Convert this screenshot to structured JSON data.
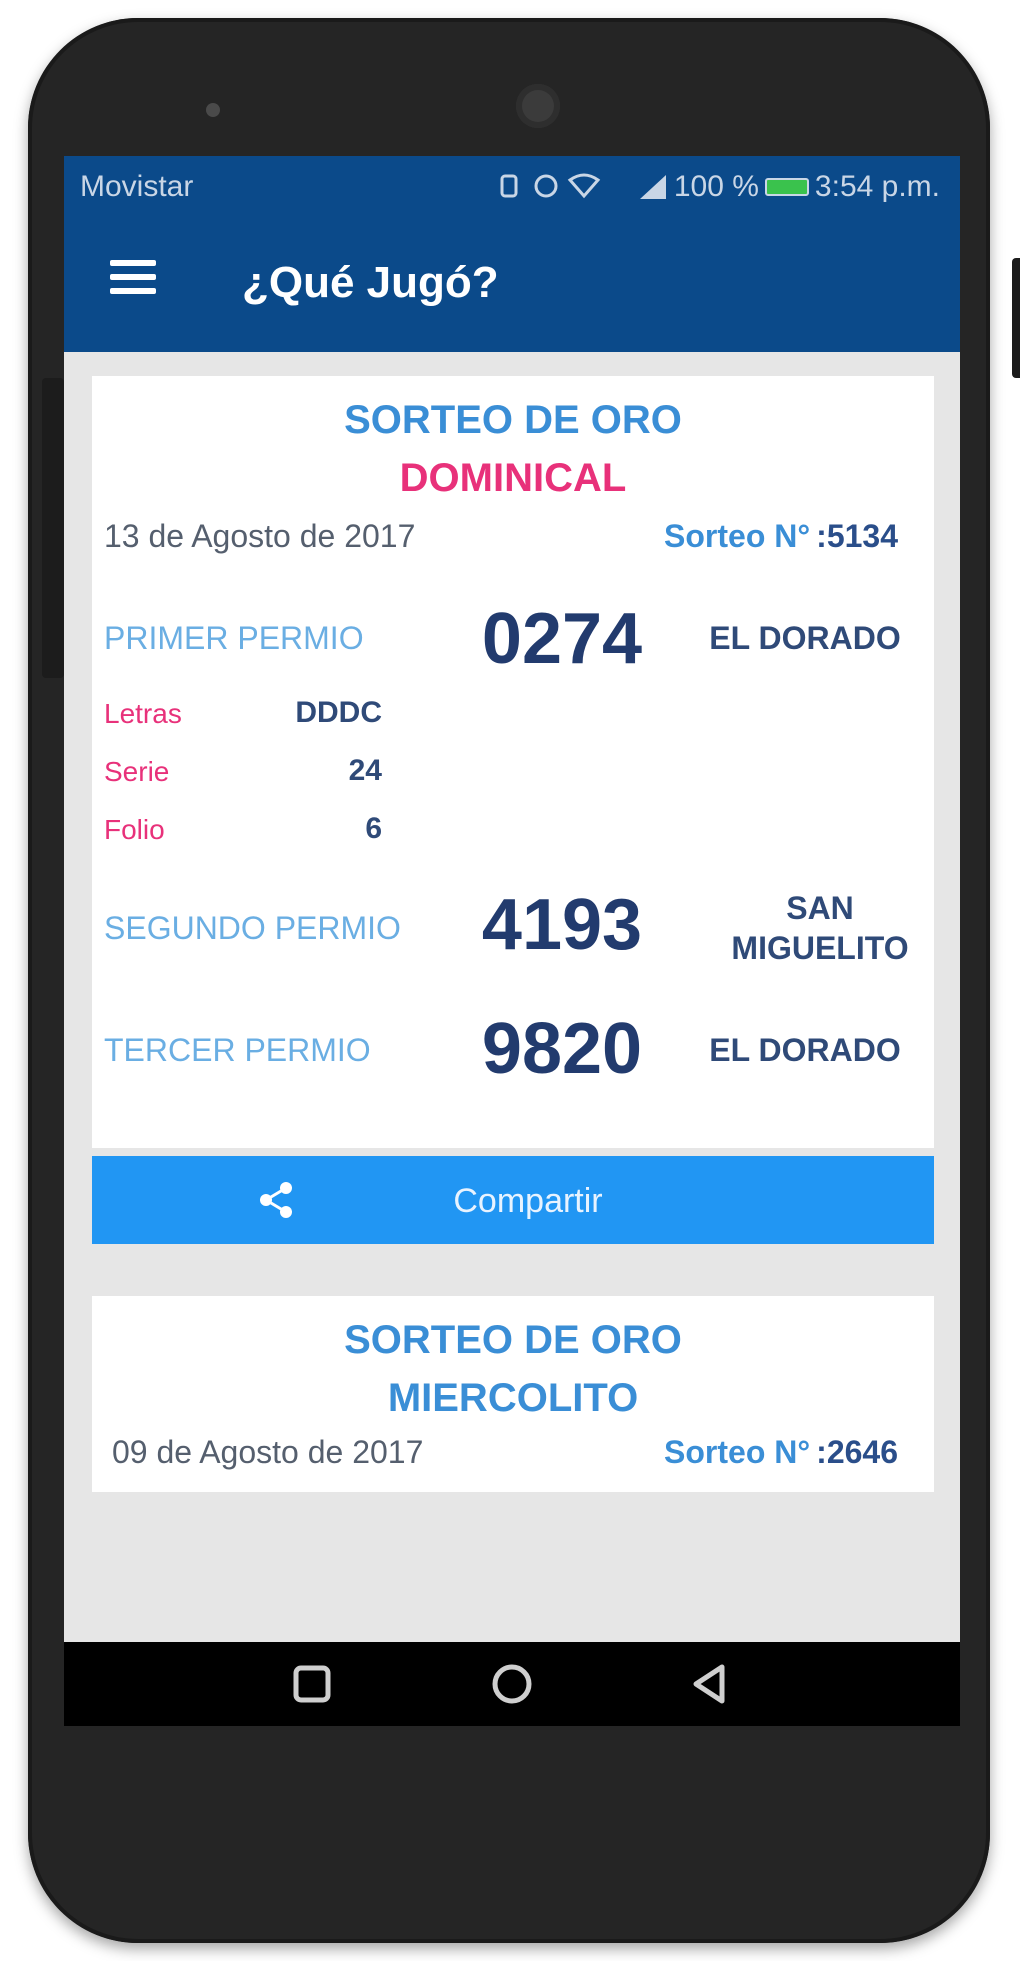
{
  "status_bar": {
    "carrier": "Movistar",
    "battery": "100 %",
    "time": "3:54 p.m."
  },
  "app_bar": {
    "title": "¿Qué Jugó?"
  },
  "cards": [
    {
      "title": "SORTEO DE ORO",
      "subtitle": "DOMINICAL",
      "subtitle_color": "#e8317a",
      "date": "13 de Agosto de 2017",
      "sorteo_label": "Sorteo N°",
      "sorteo_number": ":5134",
      "prizes": [
        {
          "label": "PRIMER PERMIO",
          "number": "0274",
          "place": "EL DORADO"
        },
        {
          "label": "SEGUNDO PERMIO",
          "number": "4193",
          "place": "SAN MIGUELITO"
        },
        {
          "label": "TERCER PERMIO",
          "number": "9820",
          "place": "EL DORADO"
        }
      ],
      "details": [
        {
          "label": "Letras",
          "value": "DDDC"
        },
        {
          "label": "Serie",
          "value": "24"
        },
        {
          "label": "Folio",
          "value": "6"
        }
      ],
      "share_label": "Compartir"
    },
    {
      "title": "SORTEO DE ORO",
      "subtitle": "MIERCOLITO",
      "subtitle_color": "#3a8ed6",
      "date": "09 de Agosto de 2017",
      "sorteo_label": "Sorteo N°",
      "sorteo_number": ":2646"
    }
  ],
  "colors": {
    "app_bar": "#0b4a8a",
    "accent_blue": "#3a8ed6",
    "accent_pink": "#e8317a",
    "share_button": "#2196f3"
  },
  "icons": [
    "menu-icon",
    "share-icon",
    "nav-recents-icon",
    "nav-home-icon",
    "nav-back-icon",
    "wifi-icon",
    "signal-icon",
    "battery-icon"
  ]
}
